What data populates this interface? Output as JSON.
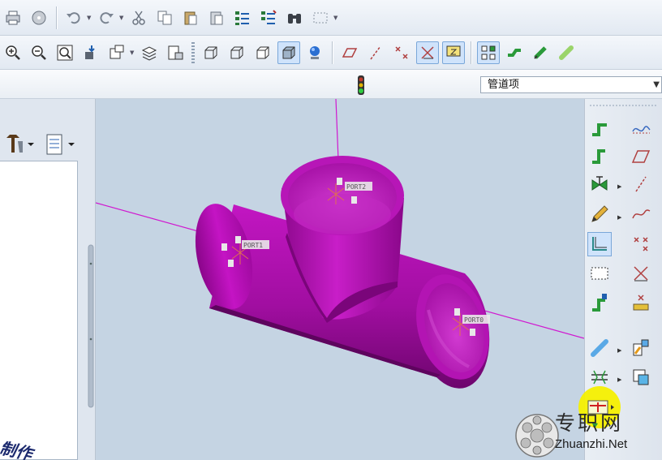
{
  "selection_filter": {
    "value": "管道项"
  },
  "ports": [
    "PORT2",
    "PORT1",
    "PORT0"
  ],
  "watermark_partial": "制作",
  "logo": {
    "name": "专职网",
    "url": "Zhuanzhi.Net"
  },
  "colors": {
    "model": "#b814b8",
    "viewport_bg": "#c5d4e3",
    "axis_line": "#d018d0",
    "toolbar_bg": "#e2e9f2"
  }
}
